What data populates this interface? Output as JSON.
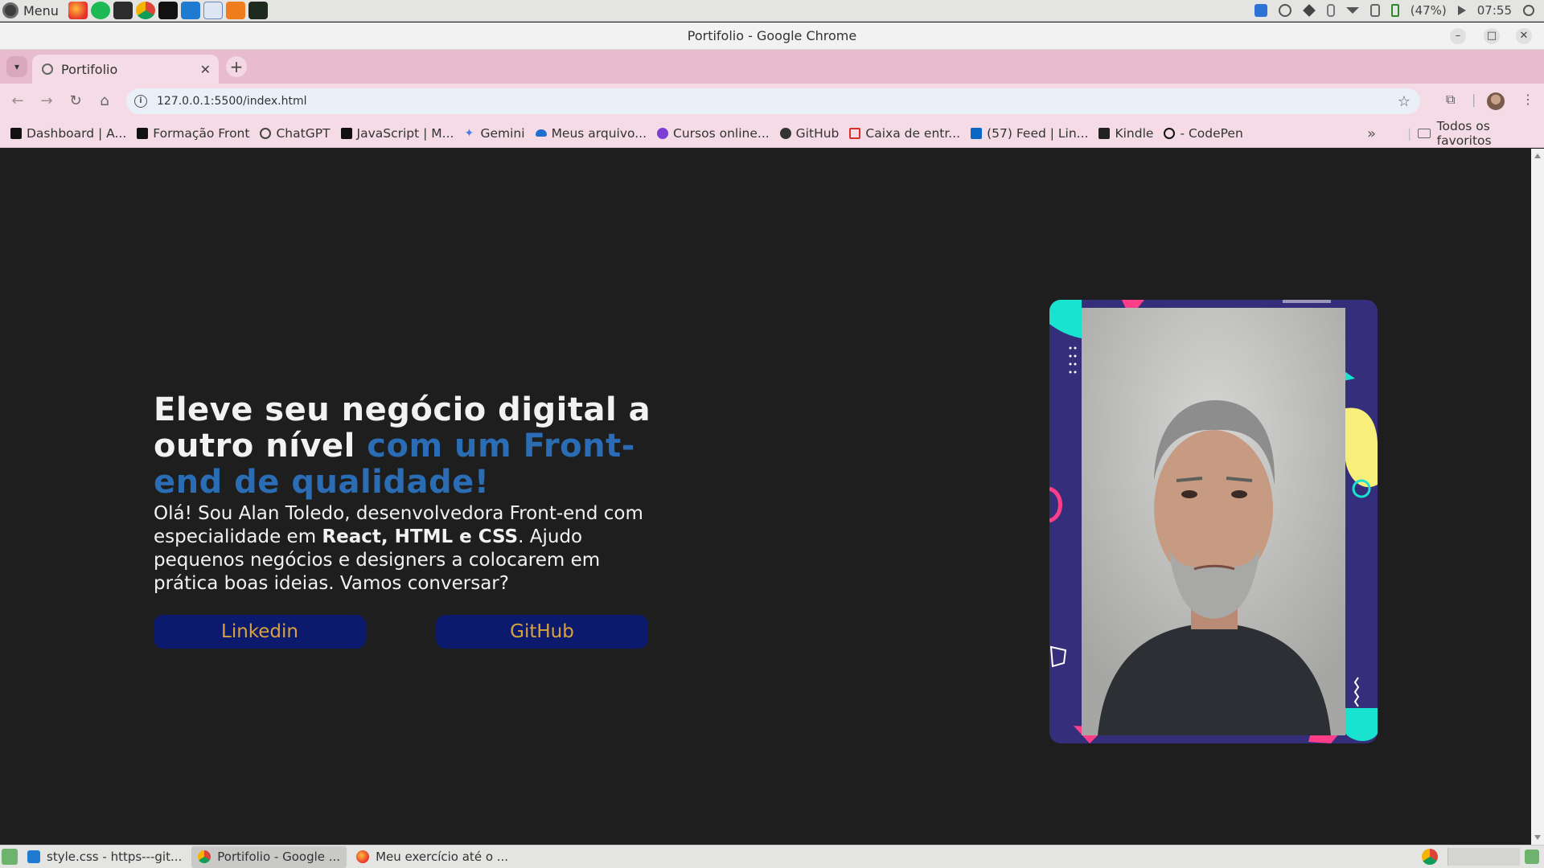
{
  "system_panel": {
    "menu_label": "Menu",
    "battery": "(47%)",
    "clock": "07:55"
  },
  "window": {
    "title": "Portifolio - Google Chrome"
  },
  "tabs": [
    {
      "label": "Portifolio"
    }
  ],
  "address_bar": {
    "url": "127.0.0.1:5500/index.html"
  },
  "bookmarks": [
    {
      "label": "Dashboard | A...",
      "icon": "amazon-icon",
      "color": "#111111"
    },
    {
      "label": "Formação Front",
      "icon": "amazon-icon",
      "color": "#111111"
    },
    {
      "label": "ChatGPT",
      "icon": "chatgpt-icon",
      "color": "#444444"
    },
    {
      "label": "JavaScript | M...",
      "icon": "mdn-icon",
      "color": "#111111"
    },
    {
      "label": "Gemini",
      "icon": "gemini-icon",
      "color": "#4a7be0"
    },
    {
      "label": "Meus arquivo...",
      "icon": "onedrive-icon",
      "color": "#1f6fd1"
    },
    {
      "label": "Cursos online...",
      "icon": "courses-icon",
      "color": "#7b3fd6"
    },
    {
      "label": "GitHub",
      "icon": "github-icon",
      "color": "#333333"
    },
    {
      "label": "Caixa de entr...",
      "icon": "gmail-icon",
      "color": "#d93025"
    },
    {
      "label": "(57) Feed | Lin...",
      "icon": "linkedin-icon",
      "color": "#0a66c2"
    },
    {
      "label": "Kindle",
      "icon": "kindle-icon",
      "color": "#222222"
    },
    {
      "label": "- CodePen",
      "icon": "codepen-icon",
      "color": "#111111"
    }
  ],
  "bookmarks_all": "Todos os favoritos",
  "page": {
    "headline_part1": "Eleve seu negócio digital a outro nível ",
    "headline_accent": "com um Front-end de qualidade!",
    "intro_part1": "Olá! Sou Alan Toledo, desenvolvedora Front-end com especialidade em ",
    "intro_bold": "React, HTML e CSS",
    "intro_part2": ". Ajudo pequenos negócios e designers a colocarem em prática boas ideias. Vamos conversar?",
    "linkedin_label": "Linkedin",
    "github_label": "GitHub"
  },
  "taskbar": [
    {
      "label": "style.css - https---git...",
      "icon": "vscode-icon",
      "active": false
    },
    {
      "label": "Portifolio - Google ...",
      "icon": "chrome-icon",
      "active": true
    },
    {
      "label": "Meu exercício até o ...",
      "icon": "firefox-icon",
      "active": false
    }
  ],
  "colors": {
    "page_bg": "#1e1e1e",
    "accent_blue": "#2a6db5",
    "button_bg": "#0c1a6e",
    "button_text": "#d9a23c",
    "frame_bg": "#352e7a",
    "tab_strip": "#e8bccd"
  }
}
